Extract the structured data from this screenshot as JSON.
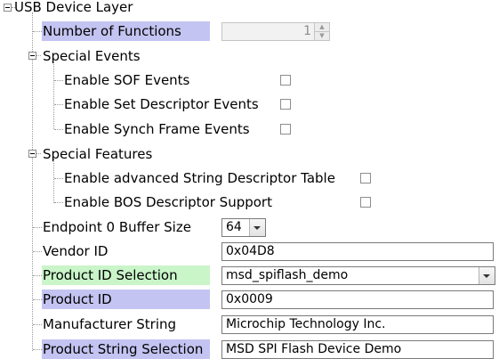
{
  "root": {
    "label": "USB Device Layer"
  },
  "number_of_functions": {
    "label": "Number of Functions",
    "value": "1"
  },
  "special_events": {
    "label": "Special Events",
    "items": [
      {
        "label": "Enable SOF Events",
        "checked": false
      },
      {
        "label": "Enable Set Descriptor Events",
        "checked": false
      },
      {
        "label": "Enable Synch Frame Events",
        "checked": false
      }
    ]
  },
  "special_features": {
    "label": "Special Features",
    "items": [
      {
        "label": "Enable advanced String Descriptor Table",
        "checked": false
      },
      {
        "label": "Enable BOS Descriptor Support",
        "checked": false
      }
    ]
  },
  "endpoint0": {
    "label": "Endpoint 0 Buffer Size",
    "value": "64"
  },
  "vendor_id": {
    "label": "Vendor ID",
    "value": "0x04D8"
  },
  "product_id_selection": {
    "label": "Product ID Selection",
    "value": "msd_spiflash_demo"
  },
  "product_id": {
    "label": "Product ID",
    "value": "0x0009"
  },
  "manufacturer_string": {
    "label": "Manufacturer String",
    "value": "Microchip Technology Inc."
  },
  "product_string_selection": {
    "label": "Product String Selection",
    "value": "MSD SPI Flash Device Demo"
  },
  "colors": {
    "highlight_blue": "#c4c4f2",
    "highlight_green": "#c9f5c9"
  }
}
